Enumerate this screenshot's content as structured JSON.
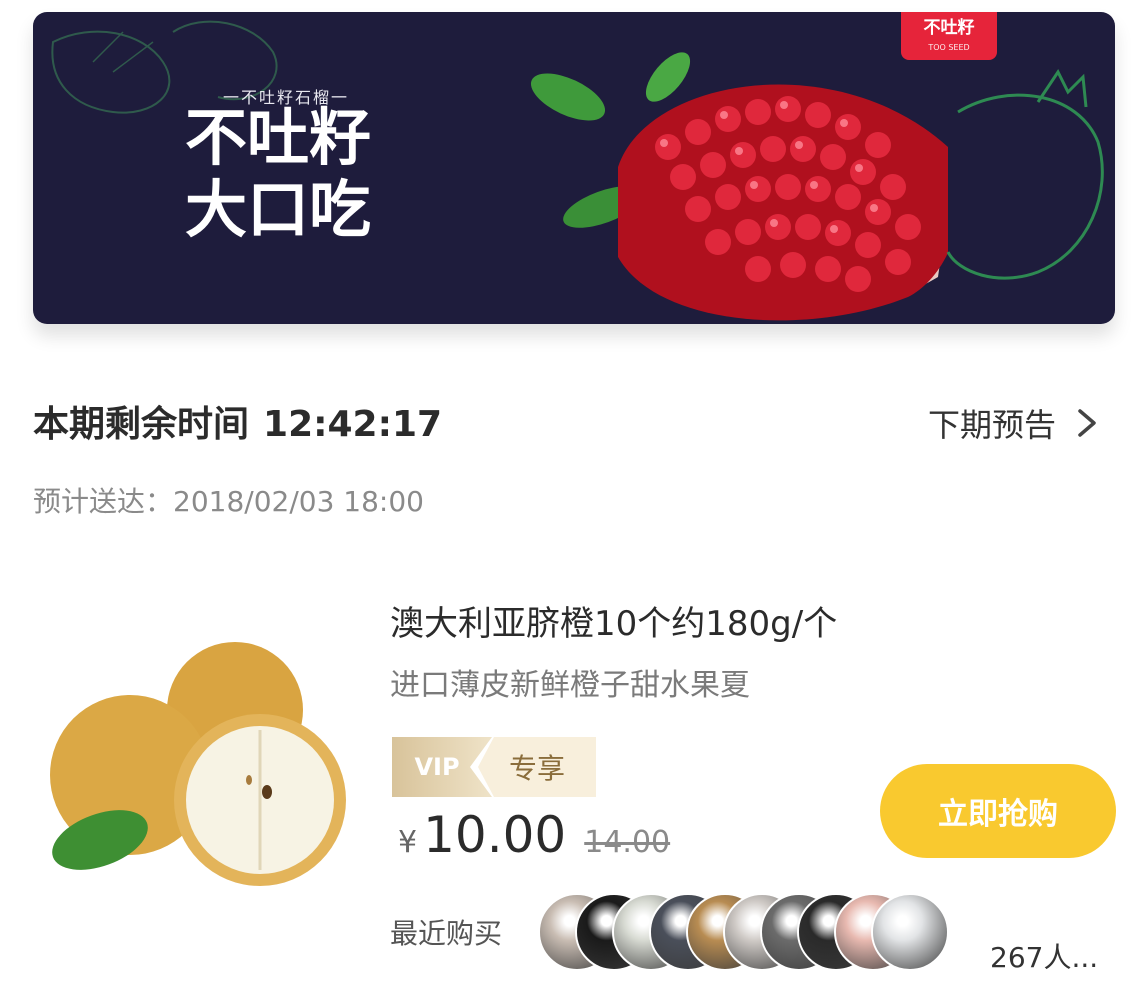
{
  "banner": {
    "tagline": "一不吐籽石榴一",
    "title_line1": "不吐籽",
    "title_line2": "大口吃",
    "brand_logo_text": "不吐籽",
    "brand_logo_subtext": "TOO SEED",
    "background_color": "#1e1c3c",
    "brand_color": "#e6243a"
  },
  "countdown": {
    "label": "本期剩余时间",
    "time": "12:42:17"
  },
  "next_preview": {
    "label": "下期预告",
    "icon": "chevron-right-icon"
  },
  "delivery": {
    "label": "预计送达：",
    "datetime": "2018/02/03 18:00"
  },
  "product": {
    "title": "澳大利亚脐橙10个约180g/个",
    "subtitle": "进口薄皮新鲜橙子甜水果夏",
    "vip_label": "VIP",
    "exclusive_label": "专享",
    "currency_symbol": "¥",
    "price": "10.00",
    "original_price": "14.00",
    "buy_button_label": "立即抢购",
    "buy_button_color": "#f9c92f"
  },
  "recent_buyers": {
    "label": "最近购买",
    "count_text": "267人...",
    "avatars": [
      {
        "color": "#c9bdb3"
      },
      {
        "color": "#1a1a1a"
      },
      {
        "color": "#d7dad2"
      },
      {
        "color": "#4a4f5a"
      },
      {
        "color": "#b88c52"
      },
      {
        "color": "#cfcac6"
      },
      {
        "color": "#6b6b6b"
      },
      {
        "color": "#2a2a2a"
      },
      {
        "color": "#e8b9b0"
      },
      {
        "color": "#e2e4e6"
      }
    ]
  }
}
